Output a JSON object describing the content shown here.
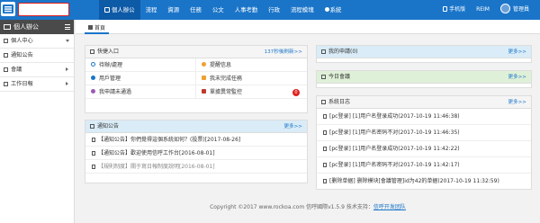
{
  "topbar": {
    "nav": [
      {
        "label": "個人辦公",
        "active": true
      },
      {
        "label": "流程"
      },
      {
        "label": "資源"
      },
      {
        "label": "任務"
      },
      {
        "label": "公文"
      },
      {
        "label": "人事考勤"
      },
      {
        "label": "行政"
      },
      {
        "label": "流程模塊"
      },
      {
        "label": "系統"
      }
    ],
    "right": {
      "mobile": "手机版",
      "reim": "REIM",
      "user": "管理員"
    }
  },
  "sidebar": {
    "title": "個人辦公",
    "items": [
      {
        "label": "個人中心"
      },
      {
        "label": "通知公告"
      },
      {
        "label": "會議"
      },
      {
        "label": "工作日報"
      }
    ]
  },
  "tabs": {
    "home": "首頁"
  },
  "quick": {
    "title": "快捷入口",
    "refresh": "137秒後刷新>>",
    "items": [
      {
        "label": "待辦/處理"
      },
      {
        "label": "提醒信息"
      },
      {
        "label": "用戶管理"
      },
      {
        "label": "我未完成任務"
      },
      {
        "label": "我申請未通過"
      },
      {
        "label": "單據異常監控",
        "badge": "0"
      }
    ]
  },
  "notice": {
    "title": "通知公告",
    "more": "更多>>",
    "items": [
      "【通知公告】你們覺得這個系統如何？(投票)[2017-08-26]",
      "【通知公告】歡迎使用信呼工作台[2016-08-01]",
      "【規則制度】關于寫日報制度說明[2016-08-01]"
    ]
  },
  "apply": {
    "title": "我的申請(0)",
    "more": "更多>>"
  },
  "meeting": {
    "title": "今日會議",
    "more": "更多>>"
  },
  "syslog": {
    "title": "系統日志",
    "more": "更多>>",
    "items": [
      "[pc登录] [1]用户名登录成功(2017-10-19 11:46:38)",
      "[pc登录] [1]用户名密码不对(2017-10-19 11:46:35)",
      "[pc登录] [1]用户名登录成功(2017-10-19 11:42:22)",
      "[pc登录] [1]用户名密码不对(2017-10-19 11:42:17)",
      "[删除单据] 删除模块[會議管理]id为42的单据(2017-10-19 11:32:59)"
    ]
  },
  "footer": {
    "text": "Copyright ©2017  www.rockoa.com  信呼國際v1.5.9  技术支持：",
    "link": "信呼开发团队"
  },
  "colors": {
    "brand": "#1a75c9",
    "badge": "#e02020"
  }
}
